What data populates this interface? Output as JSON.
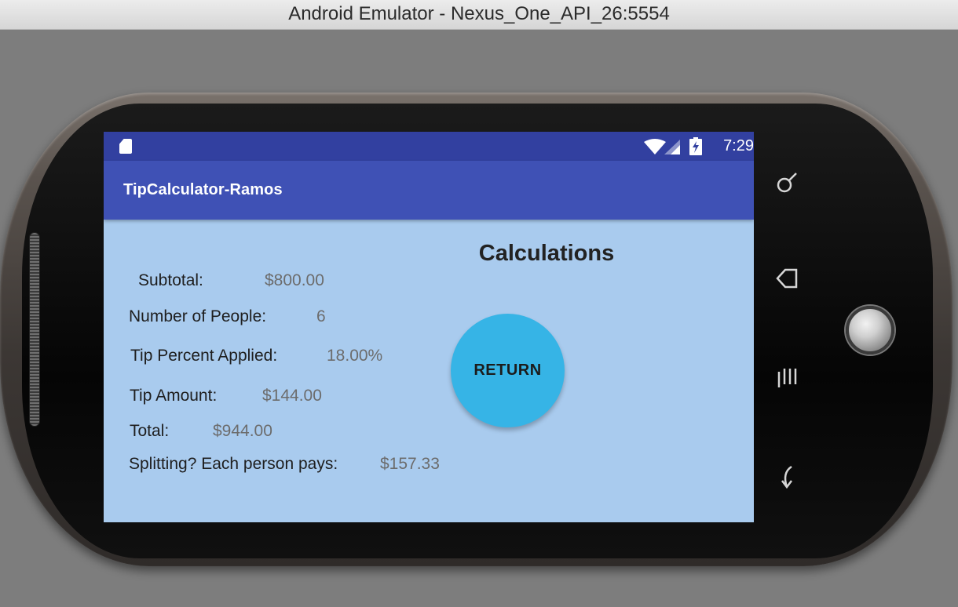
{
  "window": {
    "title": "Android Emulator - Nexus_One_API_26:5554"
  },
  "status_bar": {
    "time": "7:29",
    "icons": [
      "sd-card-icon",
      "wifi-icon",
      "cell-signal-icon",
      "battery-charging-icon"
    ]
  },
  "app_bar": {
    "title": "TipCalculator-Ramos"
  },
  "screen": {
    "heading": "Calculations",
    "rows": {
      "subtotal": {
        "label": "Subtotal:",
        "value": "$800.00"
      },
      "people": {
        "label": "Number of People:",
        "value": "6"
      },
      "tip_percent": {
        "label": "Tip Percent Applied:",
        "value": "18.00%"
      },
      "tip_amount": {
        "label": "Tip Amount:",
        "value": "$144.00"
      },
      "total": {
        "label": "Total:",
        "value": "$944.00"
      },
      "split": {
        "label": "Splitting? Each person pays:",
        "value": "$157.33"
      }
    },
    "return_button": "RETURN"
  },
  "hardware_keys": [
    "search-key-icon",
    "home-key-icon",
    "menu-key-icon",
    "back-key-icon",
    "trackball"
  ],
  "colors": {
    "status_bar": "#3240a0",
    "app_bar": "#3f51b5",
    "screen_bg": "#a9cbee",
    "fab": "#36b4e6"
  }
}
